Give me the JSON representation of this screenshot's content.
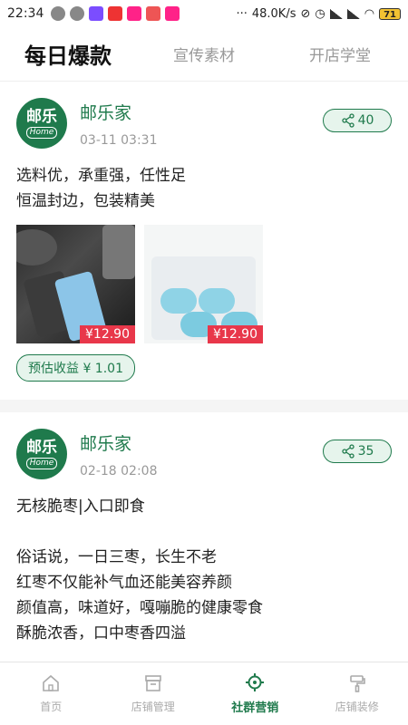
{
  "status": {
    "time": "22:34",
    "net_speed": "48.0K/s",
    "battery": "71"
  },
  "tabs": [
    {
      "label": "每日爆款",
      "active": true
    },
    {
      "label": "宣传素材",
      "active": false
    },
    {
      "label": "开店学堂",
      "active": false
    }
  ],
  "posts": [
    {
      "logo_top": "邮乐",
      "logo_bottom": "Home",
      "shop": "邮乐家",
      "time": "03-11 03:31",
      "share_count": "40",
      "text": "选料优，承重强，任性足\n恒温封边，包装精美",
      "images": [
        {
          "price": "¥12.90",
          "icon": "dark-trash-bag-product-icon"
        },
        {
          "price": "¥12.90",
          "icon": "blue-trash-bag-pack-icon"
        }
      ],
      "earning": "预估收益 ¥ 1.01"
    },
    {
      "logo_top": "邮乐",
      "logo_bottom": "Home",
      "shop": "邮乐家",
      "time": "02-18 02:08",
      "share_count": "35",
      "text": "无核脆枣|入口即食\n\n俗话说，一日三枣，长生不老\n红枣不仅能补气血还能美容养颜\n颜值高，味道好，嘎嘣脆的健康零食\n酥脆浓香，口中枣香四溢"
    }
  ],
  "bottom_nav": [
    {
      "label": "首页",
      "icon": "home-icon",
      "active": false
    },
    {
      "label": "店铺管理",
      "icon": "store-box-icon",
      "active": false
    },
    {
      "label": "社群营销",
      "icon": "target-icon",
      "active": true
    },
    {
      "label": "店铺装修",
      "icon": "paint-roller-icon",
      "active": false
    }
  ],
  "colors": {
    "brand": "#1f7a4c",
    "price": "#e8374a"
  }
}
